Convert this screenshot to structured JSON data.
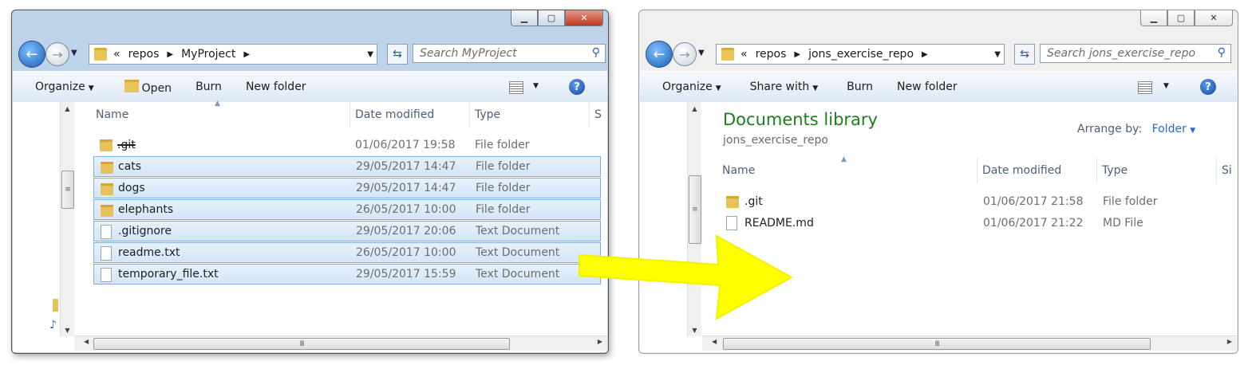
{
  "left_window": {
    "breadcrumb": [
      "repos",
      "MyProject"
    ],
    "search_placeholder": "Search MyProject",
    "toolbar": {
      "organize": "Organize",
      "open": "Open",
      "burn": "Burn",
      "new_folder": "New folder"
    },
    "columns": {
      "name": "Name",
      "date": "Date modified",
      "type": "Type",
      "size": "S"
    },
    "files": [
      {
        "name": ".git",
        "date": "01/06/2017 19:58",
        "type": "File folder",
        "icon": "folder-icon",
        "selected": false,
        "struck": true
      },
      {
        "name": "cats",
        "date": "29/05/2017 14:47",
        "type": "File folder",
        "icon": "folder-icon",
        "selected": true,
        "struck": false
      },
      {
        "name": "dogs",
        "date": "29/05/2017 14:47",
        "type": "File folder",
        "icon": "folder-icon",
        "selected": true,
        "struck": false
      },
      {
        "name": "elephants",
        "date": "26/05/2017 10:00",
        "type": "File folder",
        "icon": "folder-icon",
        "selected": true,
        "struck": false
      },
      {
        "name": ".gitignore",
        "date": "29/05/2017 20:06",
        "type": "Text Document",
        "icon": "document-icon",
        "selected": true,
        "struck": false
      },
      {
        "name": "readme.txt",
        "date": "26/05/2017 10:00",
        "type": "Text Document",
        "icon": "document-icon",
        "selected": true,
        "struck": false
      },
      {
        "name": "temporary_file.txt",
        "date": "29/05/2017 15:59",
        "type": "Text Document",
        "icon": "document-icon",
        "selected": true,
        "struck": false
      }
    ]
  },
  "right_window": {
    "breadcrumb": [
      "repos",
      "jons_exercise_repo"
    ],
    "search_placeholder": "Search jons_exercise_repo",
    "toolbar": {
      "organize": "Organize",
      "share_with": "Share with",
      "burn": "Burn",
      "new_folder": "New folder"
    },
    "library_title": "Documents library",
    "library_subtitle": "jons_exercise_repo",
    "arrange_label": "Arrange by:",
    "arrange_value": "Folder",
    "columns": {
      "name": "Name",
      "date": "Date modified",
      "type": "Type",
      "size": "Si"
    },
    "files": [
      {
        "name": ".git",
        "date": "01/06/2017 21:58",
        "type": "File folder",
        "icon": "folder-icon"
      },
      {
        "name": "README.md",
        "date": "01/06/2017 21:22",
        "type": "MD File",
        "icon": "document-icon"
      }
    ]
  },
  "breadcrumb_prefix": "«",
  "colors": {
    "selection": "#d3e5f8",
    "library_title": "#1e7d1e",
    "arrow": "#ffff00"
  }
}
